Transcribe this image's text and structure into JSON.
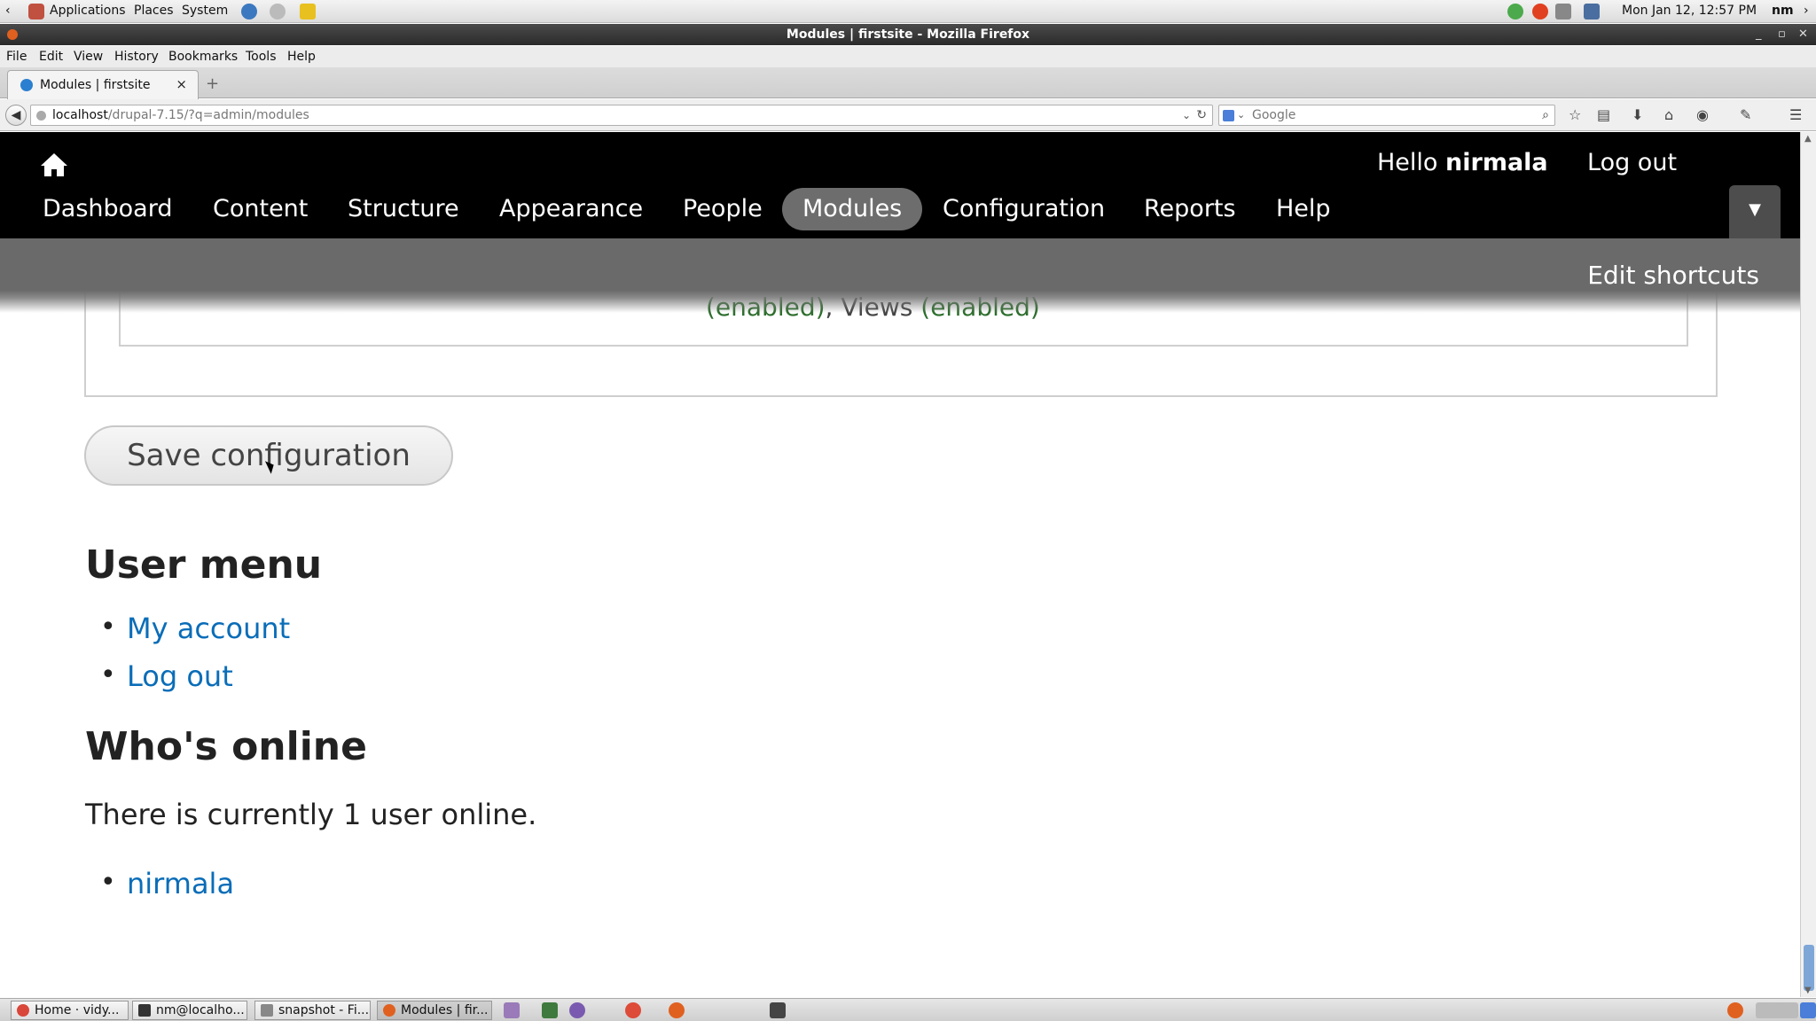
{
  "panel": {
    "applications": "Applications",
    "places": "Places",
    "system": "System",
    "clock": "Mon Jan 12, 12:57 PM",
    "user": "nm"
  },
  "window": {
    "title": "Modules | firstsite - Mozilla Firefox"
  },
  "menubar": [
    "File",
    "Edit",
    "View",
    "History",
    "Bookmarks",
    "Tools",
    "Help"
  ],
  "tab": {
    "label": "Modules | firstsite",
    "close": "×",
    "new": "+"
  },
  "nav": {
    "url_host": "localhost",
    "url_path": "/drupal-7.15/?q=admin/modules",
    "search_placeholder": "Google"
  },
  "toolbar": {
    "hello": "Hello",
    "username": "nirmala",
    "logout": "Log out",
    "items": [
      "Dashboard",
      "Content",
      "Structure",
      "Appearance",
      "People",
      "Modules",
      "Configuration",
      "Reports",
      "Help"
    ],
    "active": "Modules"
  },
  "shortcuts": {
    "edit": "Edit shortcuts"
  },
  "content": {
    "hidden_row_1": "(enabled)",
    "hidden_row_sep": ", Views ",
    "hidden_row_2": "(enabled)",
    "save_button": "Save configuration",
    "user_menu": {
      "title": "User menu",
      "links": [
        "My account",
        "Log out"
      ]
    },
    "whos_online": {
      "title": "Who's online",
      "text": "There is currently 1 user online.",
      "users": [
        "nirmala"
      ]
    }
  },
  "taskbar": {
    "tasks": [
      "Home · vidy...",
      "nm@localho...",
      "snapshot - Fi...",
      "Modules | fir..."
    ]
  },
  "colors": {
    "toolbar_bg": "#000000",
    "active_pill": "#6d6d6d",
    "link": "#0a6db8"
  }
}
